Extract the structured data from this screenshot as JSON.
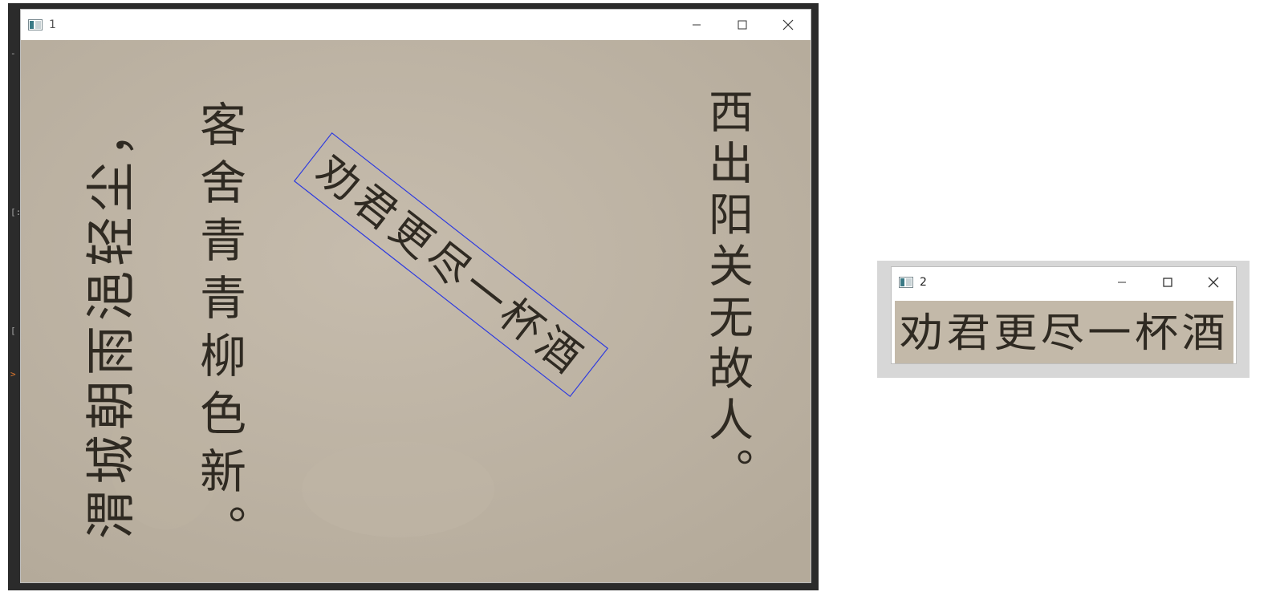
{
  "window1": {
    "title": "1",
    "controls": [
      "minimize",
      "maximize",
      "close"
    ],
    "image": {
      "columns": [
        {
          "text": "渭城朝雨浥轻尘，"
        },
        {
          "text": "客舍青青柳色新。"
        },
        {
          "text": "劝君更尽一杯酒"
        },
        {
          "text": "西出阳关无故人。"
        }
      ],
      "detection_box_color": "#2d3ae0"
    }
  },
  "window2": {
    "title": "2",
    "controls": [
      "minimize",
      "maximize",
      "close"
    ],
    "crop_text": "劝君更尽一杯酒"
  },
  "background": {
    "gutter_marks": [
      "-",
      "[:",
      "[",
      ">"
    ]
  },
  "colors": {
    "paper": "#c2b8a8",
    "ink": "#2f2a22",
    "box": "#2d3ae0"
  }
}
